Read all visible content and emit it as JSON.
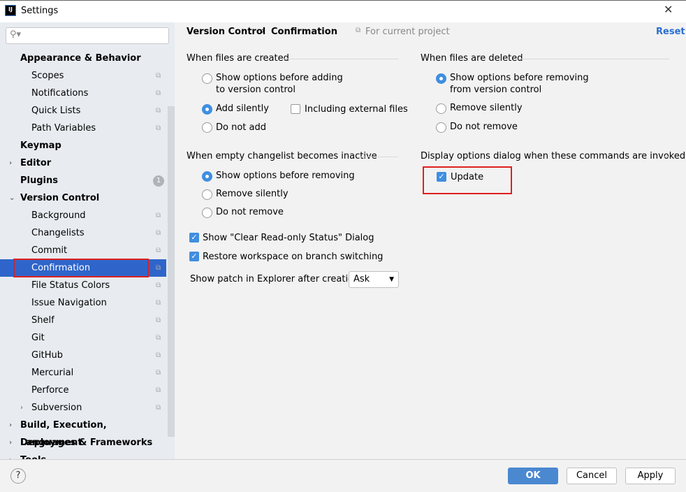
{
  "window": {
    "title": "Settings",
    "app_icon": "IJ"
  },
  "search": {
    "placeholder": ""
  },
  "sidebar": {
    "items": [
      {
        "label": "Appearance & Behavior",
        "bold": true,
        "level": 0
      },
      {
        "label": "Scopes",
        "level": 1
      },
      {
        "label": "Notifications",
        "level": 1
      },
      {
        "label": "Quick Lists",
        "level": 1
      },
      {
        "label": "Path Variables",
        "level": 1
      },
      {
        "label": "Keymap",
        "bold": true,
        "level": 0
      },
      {
        "label": "Editor",
        "bold": true,
        "level": 0,
        "arrow": "right"
      },
      {
        "label": "Plugins",
        "bold": true,
        "level": 0,
        "badge": "1"
      },
      {
        "label": "Version Control",
        "bold": true,
        "level": 0,
        "arrow": "down"
      },
      {
        "label": "Background",
        "level": 1
      },
      {
        "label": "Changelists",
        "level": 1
      },
      {
        "label": "Commit",
        "level": 1
      },
      {
        "label": "Confirmation",
        "level": 1,
        "selected": true
      },
      {
        "label": "File Status Colors",
        "level": 1
      },
      {
        "label": "Issue Navigation",
        "level": 1
      },
      {
        "label": "Shelf",
        "level": 1
      },
      {
        "label": "Git",
        "level": 1
      },
      {
        "label": "GitHub",
        "level": 1
      },
      {
        "label": "Mercurial",
        "level": 1
      },
      {
        "label": "Perforce",
        "level": 1
      },
      {
        "label": "Subversion",
        "level": 1,
        "arrow": "right"
      },
      {
        "label": "Build, Execution, Deployment",
        "bold": true,
        "level": 0,
        "arrow": "right"
      },
      {
        "label": "Languages & Frameworks",
        "bold": true,
        "level": 0,
        "arrow": "right"
      },
      {
        "label": "Tools",
        "bold": true,
        "level": 0,
        "arrow": "right"
      }
    ]
  },
  "breadcrumb": {
    "parent": "Version Control",
    "current": "Confirmation",
    "scope": "For current project",
    "reset": "Reset"
  },
  "created": {
    "title": "When files are created",
    "opt1": "Show options before adding",
    "opt1b": "to version control",
    "opt2": "Add silently",
    "opt3": "Do not add",
    "external": "Including external files",
    "selected": 2
  },
  "deleted": {
    "title": "When files are deleted",
    "opt1": "Show options before removing",
    "opt1b": "from version control",
    "opt2": "Remove silently",
    "opt3": "Do not remove",
    "selected": 1
  },
  "empty": {
    "title": "When empty changelist becomes inactive",
    "opt1": "Show options before removing",
    "opt2": "Remove silently",
    "opt3": "Do not remove",
    "selected": 1
  },
  "display": {
    "title": "Display options dialog when these commands are invoked",
    "update": "Update"
  },
  "checks": {
    "clear": "Show \"Clear Read-only Status\" Dialog",
    "restore": "Restore workspace on branch switching"
  },
  "patch": {
    "label": "Show patch in Explorer after creation:",
    "value": "Ask"
  },
  "buttons": {
    "ok": "OK",
    "cancel": "Cancel",
    "apply": "Apply",
    "help": "?"
  },
  "colors": {
    "accent": "#3f8fe0",
    "selection": "#2f65ca",
    "highlight": "#e02020"
  }
}
